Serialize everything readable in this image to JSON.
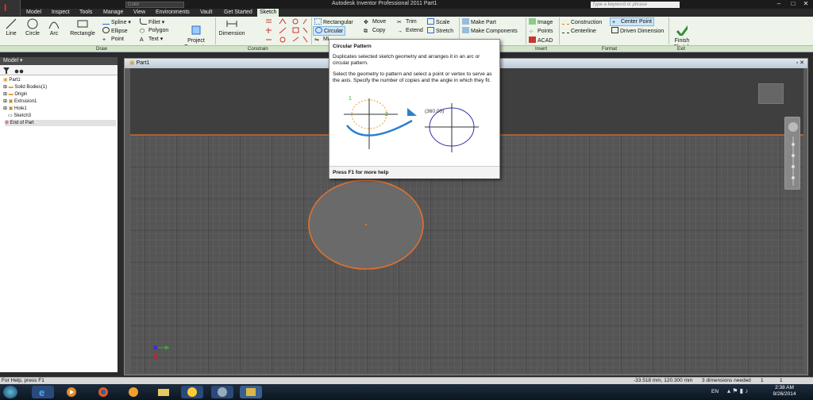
{
  "title_bar": {
    "title": "Autodesk Inventor Professional 2011    Part1",
    "search_placeholder": "Type a keyword or phrase",
    "color_field": "Color",
    "win_minimize": "–",
    "win_maximize": "□",
    "win_close": "✕"
  },
  "tabs": [
    "Model",
    "Inspect",
    "Tools",
    "Manage",
    "View",
    "Environments",
    "Vault",
    "Get Started",
    "Sketch"
  ],
  "active_tab": "Sketch",
  "ribbon": {
    "draw": {
      "line": "Line",
      "circle": "Circle",
      "arc": "Arc",
      "rectangle": "Rectangle",
      "spline": "Spline",
      "ellipse": "Ellipse",
      "point": "Point",
      "fillet": "Fillet",
      "polygon": "Polygon",
      "text": "Text",
      "project": "Project\nGeometry",
      "panel": "Draw"
    },
    "constrain": {
      "dimension": "Dimension",
      "panel": "Constrain"
    },
    "pattern": {
      "rectangular": "Rectangular",
      "circular": "Circular",
      "mirror": "Mi"
    },
    "modify": {
      "move": "Move",
      "copy": "Copy",
      "trim": "Trim",
      "extend": "Extend",
      "scale": "Scale",
      "stretch": "Stretch",
      "make_part": "Make Part",
      "make_components": "Make Components"
    },
    "insert": {
      "image": "Image",
      "points": "Points",
      "acad": "ACAD",
      "panel": "Insert"
    },
    "format": {
      "construction": "Construction",
      "centerline": "Centerline",
      "center_point": "Center Point",
      "driven_dimension": "Driven Dimension",
      "panel": "Format"
    },
    "exit": {
      "finish": "Finish\nSketch",
      "panel": "Exit"
    }
  },
  "browser": {
    "header": "Model ▾",
    "items": [
      "Part1",
      "Solid Bodies(1)",
      "Origin",
      "Extrusion1",
      "Hole1",
      "Sketch3",
      "End of Part"
    ]
  },
  "document": {
    "title": "Part1"
  },
  "tooltip": {
    "title": "Circular Pattern",
    "desc1": "Duplicates selected sketch geometry and arranges it in an arc or circular pattern.",
    "desc2": "Select the geometry to pattern and select a point or vertex to serve as the axis. Specify the number of copies and the angle in which they fit.",
    "help": "Press F1 for more help",
    "fig_label1": "1",
    "fig_label2": "2",
    "fig_label3": "(360.00)"
  },
  "status": {
    "help": "For Help, press F1",
    "coords": "-33.518 mm, 120.300 mm",
    "dims": "3 dimensions needed",
    "n1": "1",
    "n2": "1"
  },
  "taskbar": {
    "lang": "EN",
    "time": "2:38 AM",
    "date": "9/26/2014"
  },
  "colors": {
    "sketch_orange": "#e07030",
    "accent": "#3b8a3b"
  }
}
